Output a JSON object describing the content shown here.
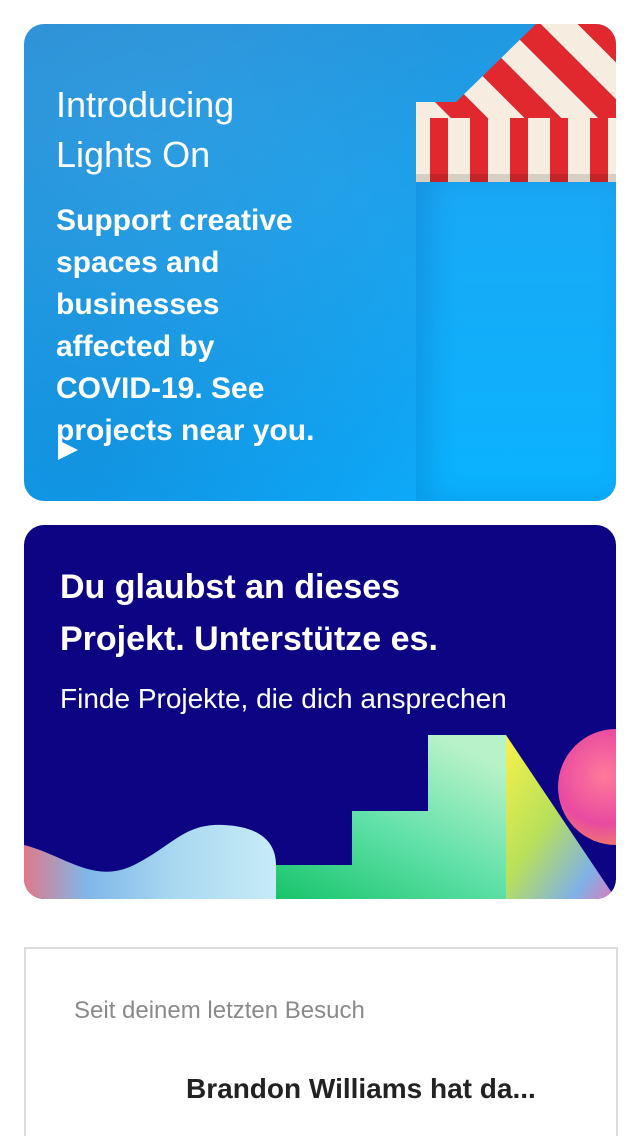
{
  "lights_on_card": {
    "title_line1": "Introducing",
    "title_line2": "Lights On",
    "body_line1": "Support creative",
    "body_line2": "spaces and",
    "body_line3": "businesses",
    "body_line4": "affected by",
    "body_line5": "COVID-19. See",
    "body_line6": "projects near you.",
    "play_icon": "play-icon",
    "awning_icon": "awning-illustration"
  },
  "believe_card": {
    "headline_line1": "Du glaubst an dieses",
    "headline_line2": "Projekt. Unterstütze es.",
    "subtitle": "Finde Projekte, die dich ansprechen",
    "background_color": "#0c0483"
  },
  "activity_card": {
    "since_label": "Seit deinem letzten Besuch",
    "activity_text": "Brandon Williams hat da..."
  }
}
